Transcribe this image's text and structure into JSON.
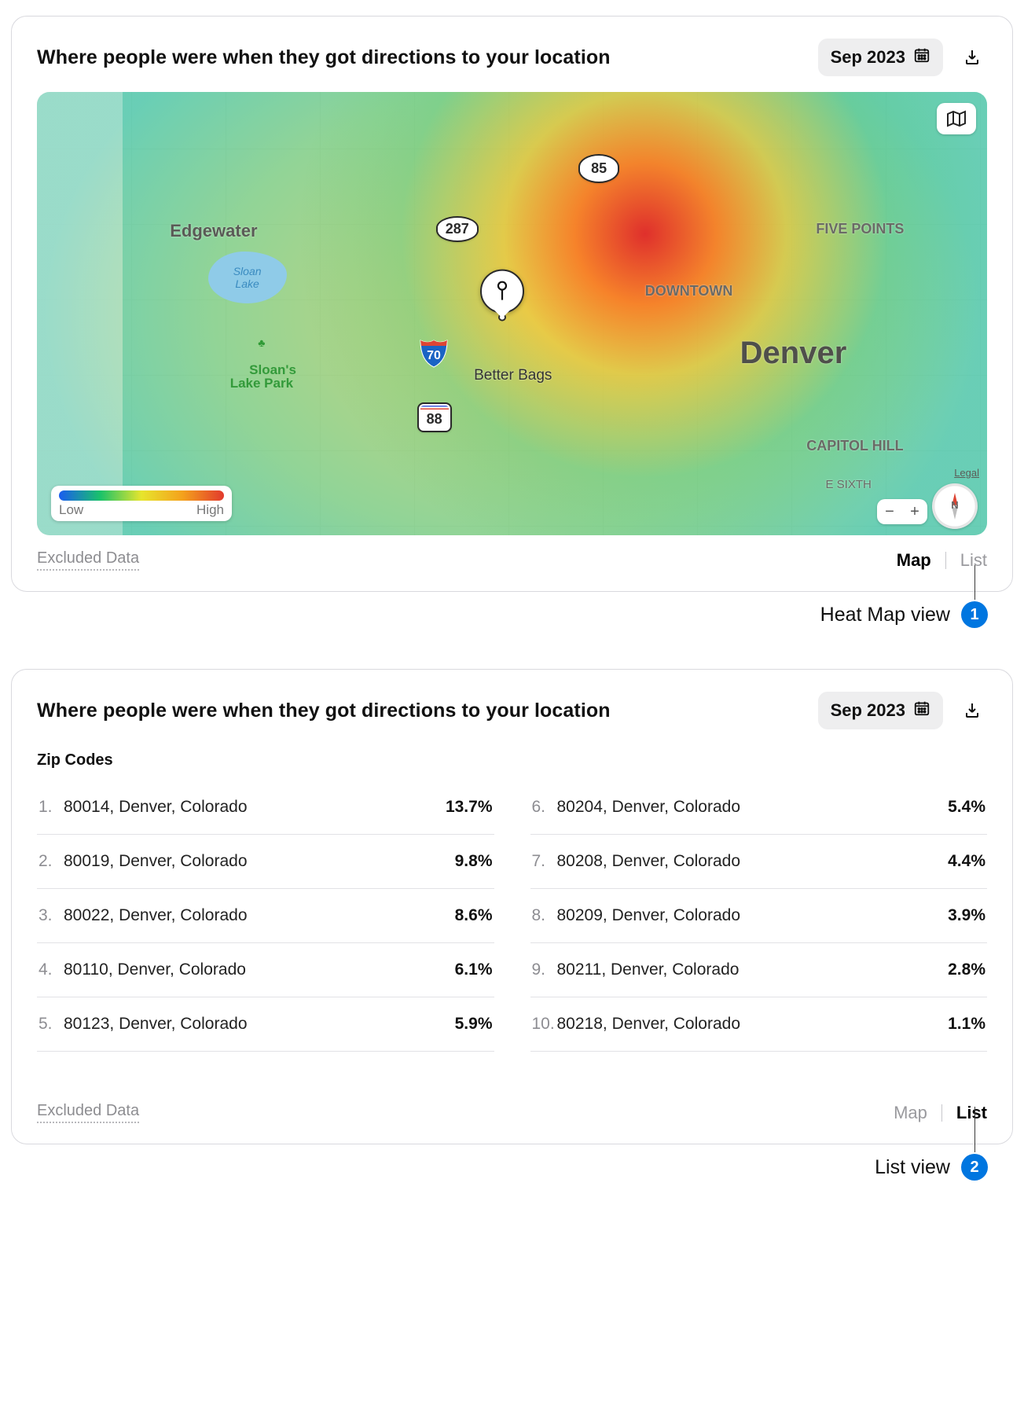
{
  "cards": {
    "map": {
      "title": "Where people were when they got directions to your location",
      "date_label": "Sep 2023",
      "excluded": "Excluded Data",
      "view_map": "Map",
      "view_list": "List"
    },
    "list": {
      "title": "Where people were when they got directions to your location",
      "date_label": "Sep 2023",
      "subhead": "Zip Codes",
      "excluded": "Excluded Data",
      "view_map": "Map",
      "view_list": "List"
    }
  },
  "map": {
    "location_name": "Better Bags",
    "legend_low": "Low",
    "legend_high": "High",
    "legal": "Legal",
    "compass": "N",
    "labels": {
      "denver": {
        "text": "Denver",
        "x": "74%",
        "y": "55%",
        "size": "40px",
        "weight": "700",
        "color": "#4f4f4b"
      },
      "downtown": {
        "text": "DOWNTOWN",
        "x": "64%",
        "y": "43%",
        "size": "18px",
        "weight": "600"
      },
      "fivepoints": {
        "text": "FIVE POINTS",
        "x": "82%",
        "y": "29%",
        "size": "18px",
        "weight": "600"
      },
      "capitol": {
        "text": "CAPITOL HILL",
        "x": "81%",
        "y": "78%",
        "size": "18px",
        "weight": "600"
      },
      "esixth": {
        "text": "E SIXTH",
        "x": "83%",
        "y": "87%",
        "size": "15px"
      },
      "edgewater": {
        "text": "Edgewater",
        "x": "14%",
        "y": "29%",
        "size": "22px",
        "weight": "700",
        "color": "#5a5a56"
      }
    },
    "park": {
      "name": "Sloan's\nLake Park",
      "lake": "Sloan\nLake"
    },
    "shields": {
      "us85": "85",
      "us287": "287",
      "co88": "88",
      "i70": "70"
    }
  },
  "zip_left": [
    {
      "rank": "1.",
      "name": "80014, Denver, Colorado",
      "pct": "13.7%"
    },
    {
      "rank": "2.",
      "name": "80019, Denver, Colorado",
      "pct": "9.8%"
    },
    {
      "rank": "3.",
      "name": "80022, Denver, Colorado",
      "pct": "8.6%"
    },
    {
      "rank": "4.",
      "name": "80110, Denver, Colorado",
      "pct": "6.1%"
    },
    {
      "rank": "5.",
      "name": "80123, Denver, Colorado",
      "pct": "5.9%"
    }
  ],
  "zip_right": [
    {
      "rank": "6.",
      "name": "80204, Denver, Colorado",
      "pct": "5.4%"
    },
    {
      "rank": "7.",
      "name": "80208, Denver, Colorado",
      "pct": "4.4%"
    },
    {
      "rank": "8.",
      "name": "80209, Denver, Colorado",
      "pct": "3.9%"
    },
    {
      "rank": "9.",
      "name": "80211, Denver, Colorado",
      "pct": "2.8%"
    },
    {
      "rank": "10.",
      "name": "80218, Denver, Colorado",
      "pct": "1.1%"
    }
  ],
  "callouts": {
    "1": "Heat Map view",
    "2": "List view"
  },
  "chart_data": {
    "type": "heatmap",
    "title": "Where people were when they got directions to your location",
    "location": "Better Bags",
    "city": "Denver",
    "legend": [
      "Low",
      "High"
    ],
    "zip_breakdown": [
      {
        "zip": "80014",
        "city": "Denver, Colorado",
        "pct": 13.7
      },
      {
        "zip": "80019",
        "city": "Denver, Colorado",
        "pct": 9.8
      },
      {
        "zip": "80022",
        "city": "Denver, Colorado",
        "pct": 8.6
      },
      {
        "zip": "80110",
        "city": "Denver, Colorado",
        "pct": 6.1
      },
      {
        "zip": "80123",
        "city": "Denver, Colorado",
        "pct": 5.9
      },
      {
        "zip": "80204",
        "city": "Denver, Colorado",
        "pct": 5.4
      },
      {
        "zip": "80208",
        "city": "Denver, Colorado",
        "pct": 4.4
      },
      {
        "zip": "80209",
        "city": "Denver, Colorado",
        "pct": 3.9
      },
      {
        "zip": "80211",
        "city": "Denver, Colorado",
        "pct": 2.8
      },
      {
        "zip": "80218",
        "city": "Denver, Colorado",
        "pct": 1.1
      }
    ]
  }
}
